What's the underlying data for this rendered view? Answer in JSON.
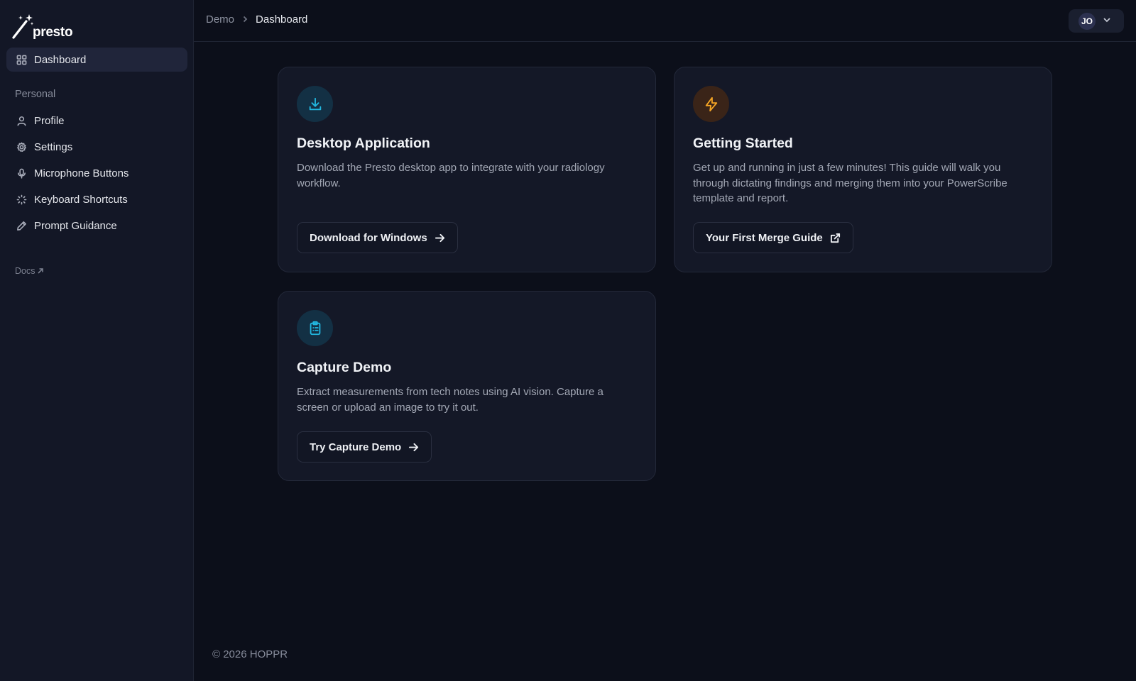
{
  "app": {
    "name": "presto"
  },
  "sidebar": {
    "dashboard_label": "Dashboard",
    "section_label": "Personal",
    "items": [
      {
        "label": "Profile",
        "icon": "user-icon"
      },
      {
        "label": "Settings",
        "icon": "gear-icon"
      },
      {
        "label": "Microphone Buttons",
        "icon": "microphone-icon"
      },
      {
        "label": "Keyboard Shortcuts",
        "icon": "loader-icon"
      },
      {
        "label": "Prompt Guidance",
        "icon": "pencil-icon"
      }
    ],
    "docs_label": "Docs"
  },
  "header": {
    "breadcrumb": [
      "Demo",
      "Dashboard"
    ],
    "user_initials": "JO"
  },
  "cards": [
    {
      "title": "Desktop Application",
      "description": "Download the Presto desktop app to integrate with your radiology workflow.",
      "button_label": "Download for Windows",
      "icon": "download-icon",
      "icon_color": "#22b8e0",
      "icon_bg": "#133044"
    },
    {
      "title": "Getting Started",
      "description": "Get up and running in just a few minutes! This guide will walk you through dictating findings and merging them into your PowerScribe template and report.",
      "button_label": "Your First Merge Guide",
      "icon": "lightning-icon",
      "icon_color": "#f5a524",
      "icon_bg": "#3a2418"
    },
    {
      "title": "Capture Demo",
      "description": "Extract measurements from tech notes using AI vision. Capture a screen or upload an image to try it out.",
      "button_label": "Try Capture Demo",
      "icon": "clipboard-list-icon",
      "icon_color": "#22b8e0",
      "icon_bg": "#133044"
    }
  ],
  "footer": {
    "text": "© 2026 HOPPR"
  }
}
